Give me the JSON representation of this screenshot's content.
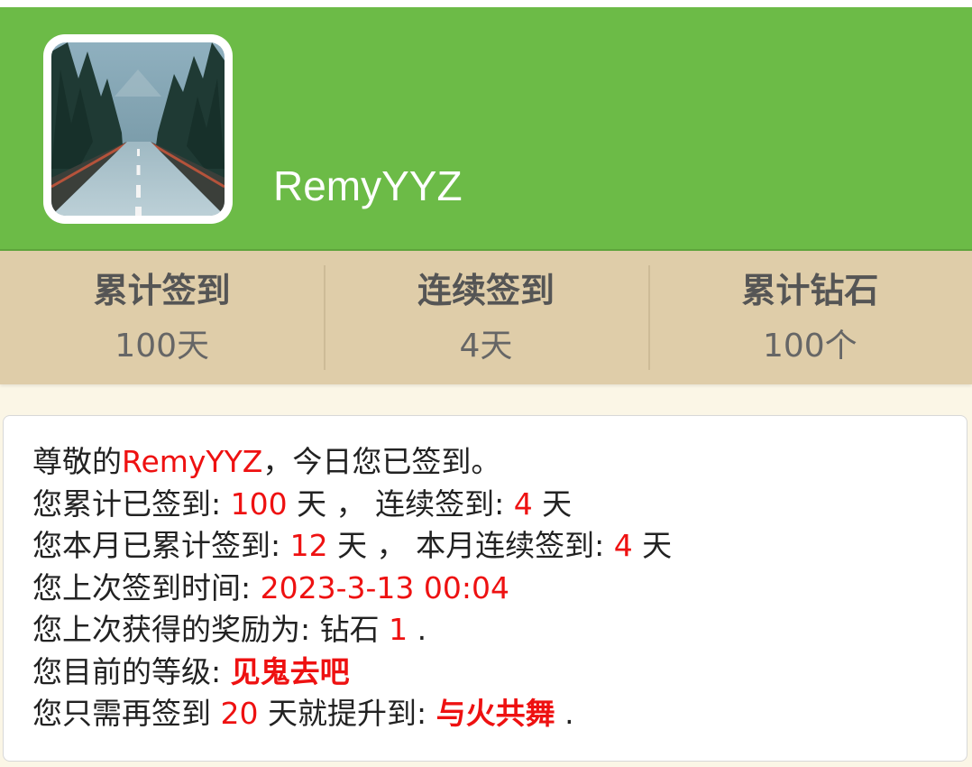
{
  "profile": {
    "username": "RemyYYZ",
    "avatar_icon": "forest-road-photo"
  },
  "stats": [
    {
      "label": "累计签到",
      "value": "100天"
    },
    {
      "label": "连续签到",
      "value": "4天"
    },
    {
      "label": "累计钻石",
      "value": "100个"
    }
  ],
  "summary": {
    "line1": {
      "prefix": "尊敬的",
      "name": "RemyYYZ",
      "suffix": "，今日您已签到。"
    },
    "line2": {
      "label": "您累计已签到: ",
      "total": "100",
      "unit1": " 天 ， 连续签到: ",
      "streak": "4",
      "unit2": " 天"
    },
    "line3": {
      "label": "您本月已累计签到: ",
      "month_total": "12",
      "unit1": " 天 ， 本月连续签到: ",
      "month_streak": "4",
      "unit2": " 天"
    },
    "line4": {
      "label": "您上次签到时间: ",
      "last_time": "2023-3-13 00:04"
    },
    "line5": {
      "label": "您上次获得的奖励为: 钻石 ",
      "reward": "1",
      "suffix": " ."
    },
    "line6": {
      "label": "您目前的等级: ",
      "level": "见鬼去吧"
    },
    "line7": {
      "label": "您只需再签到 ",
      "days_needed": "20",
      "middle": " 天就提升到: ",
      "next_level": "与火共舞",
      "suffix": " ."
    }
  },
  "colors": {
    "header_green": "#6cbb47",
    "stats_beige": "#dfcda9",
    "highlight_red": "#ee1111"
  }
}
